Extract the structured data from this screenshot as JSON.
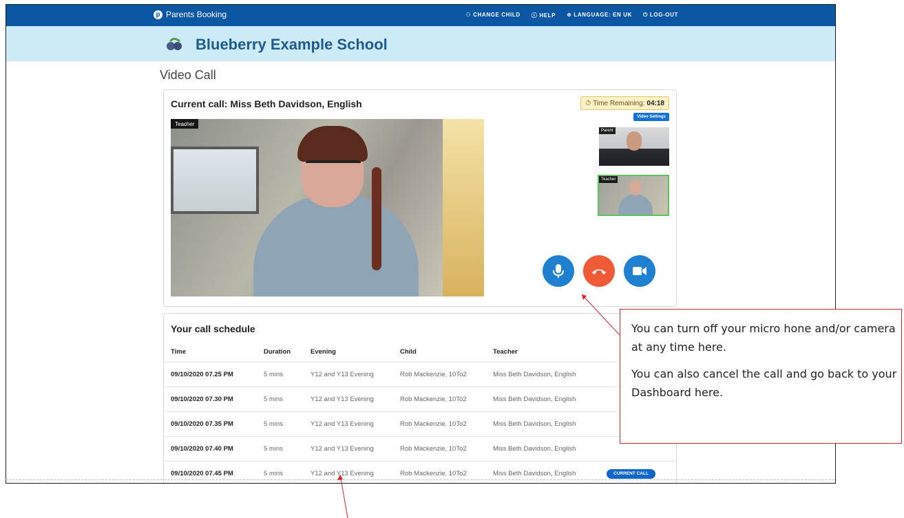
{
  "topbar": {
    "brand": "Parents Booking",
    "nav": [
      {
        "icon": "users-icon",
        "label": "CHANGE CHILD"
      },
      {
        "icon": "help-icon",
        "label": "HELP"
      },
      {
        "icon": "globe-icon",
        "label": "LANGUAGE: EN UK"
      },
      {
        "icon": "power-icon",
        "label": "LOG-OUT"
      }
    ]
  },
  "school": {
    "name": "Blueberry Example School",
    "logo": "blueberry-icon"
  },
  "page_title": "Video Call",
  "call": {
    "title": "Current call: Miss Beth Davidson, English",
    "time_remaining_label": "Time Remaining:",
    "time_remaining_value": "04:18",
    "video_settings_label": "Video Settings",
    "main_video_label": "Teacher",
    "thumb_parent_label": "Parent",
    "thumb_teacher_label": "Teacher",
    "controls": [
      "microphone-icon",
      "hang-up-icon",
      "camera-icon"
    ]
  },
  "schedule": {
    "title": "Your call schedule",
    "columns": [
      "Time",
      "Duration",
      "Evening",
      "Child",
      "Teacher"
    ],
    "rows": [
      {
        "time": "09/10/2020 07.25 PM",
        "duration": "5 mins",
        "evening": "Y12 and Y13 Evening",
        "child": "Rob Mackenzie, 10To2",
        "teacher": "Miss Beth Davidson, English",
        "status": ""
      },
      {
        "time": "09/10/2020 07.30 PM",
        "duration": "5 mins",
        "evening": "Y12 and Y13 Evening",
        "child": "Rob Mackenzie, 10To2",
        "teacher": "Miss Beth Davidson, English",
        "status": ""
      },
      {
        "time": "09/10/2020 07.35 PM",
        "duration": "5 mins",
        "evening": "Y12 and Y13 Evening",
        "child": "Rob Mackenzie, 10To2",
        "teacher": "Miss Beth Davidson, English",
        "status": ""
      },
      {
        "time": "09/10/2020 07.40 PM",
        "duration": "5 mins",
        "evening": "Y12 and Y13 Evening",
        "child": "Rob Mackenzie, 10To2",
        "teacher": "Miss Beth Davidson, English",
        "status": ""
      },
      {
        "time": "09/10/2020 07.45 PM",
        "duration": "5 mins",
        "evening": "Y12 and Y13 Evening",
        "child": "Rob Mackenzie, 10To2",
        "teacher": "Miss Beth Davidson, English",
        "status": "CURRENT CALL"
      }
    ]
  },
  "callout": {
    "line1": "You can turn off your micro hone and/or camera at any time here.",
    "line2": "You can also cancel the call and go back to your Dashboard here."
  },
  "colors": {
    "topbar": "#0b57a4",
    "school_bar": "#cdeaf7",
    "accent": "#1f7fd1",
    "hangup": "#ef5a37",
    "annotation": "#d9252b"
  }
}
